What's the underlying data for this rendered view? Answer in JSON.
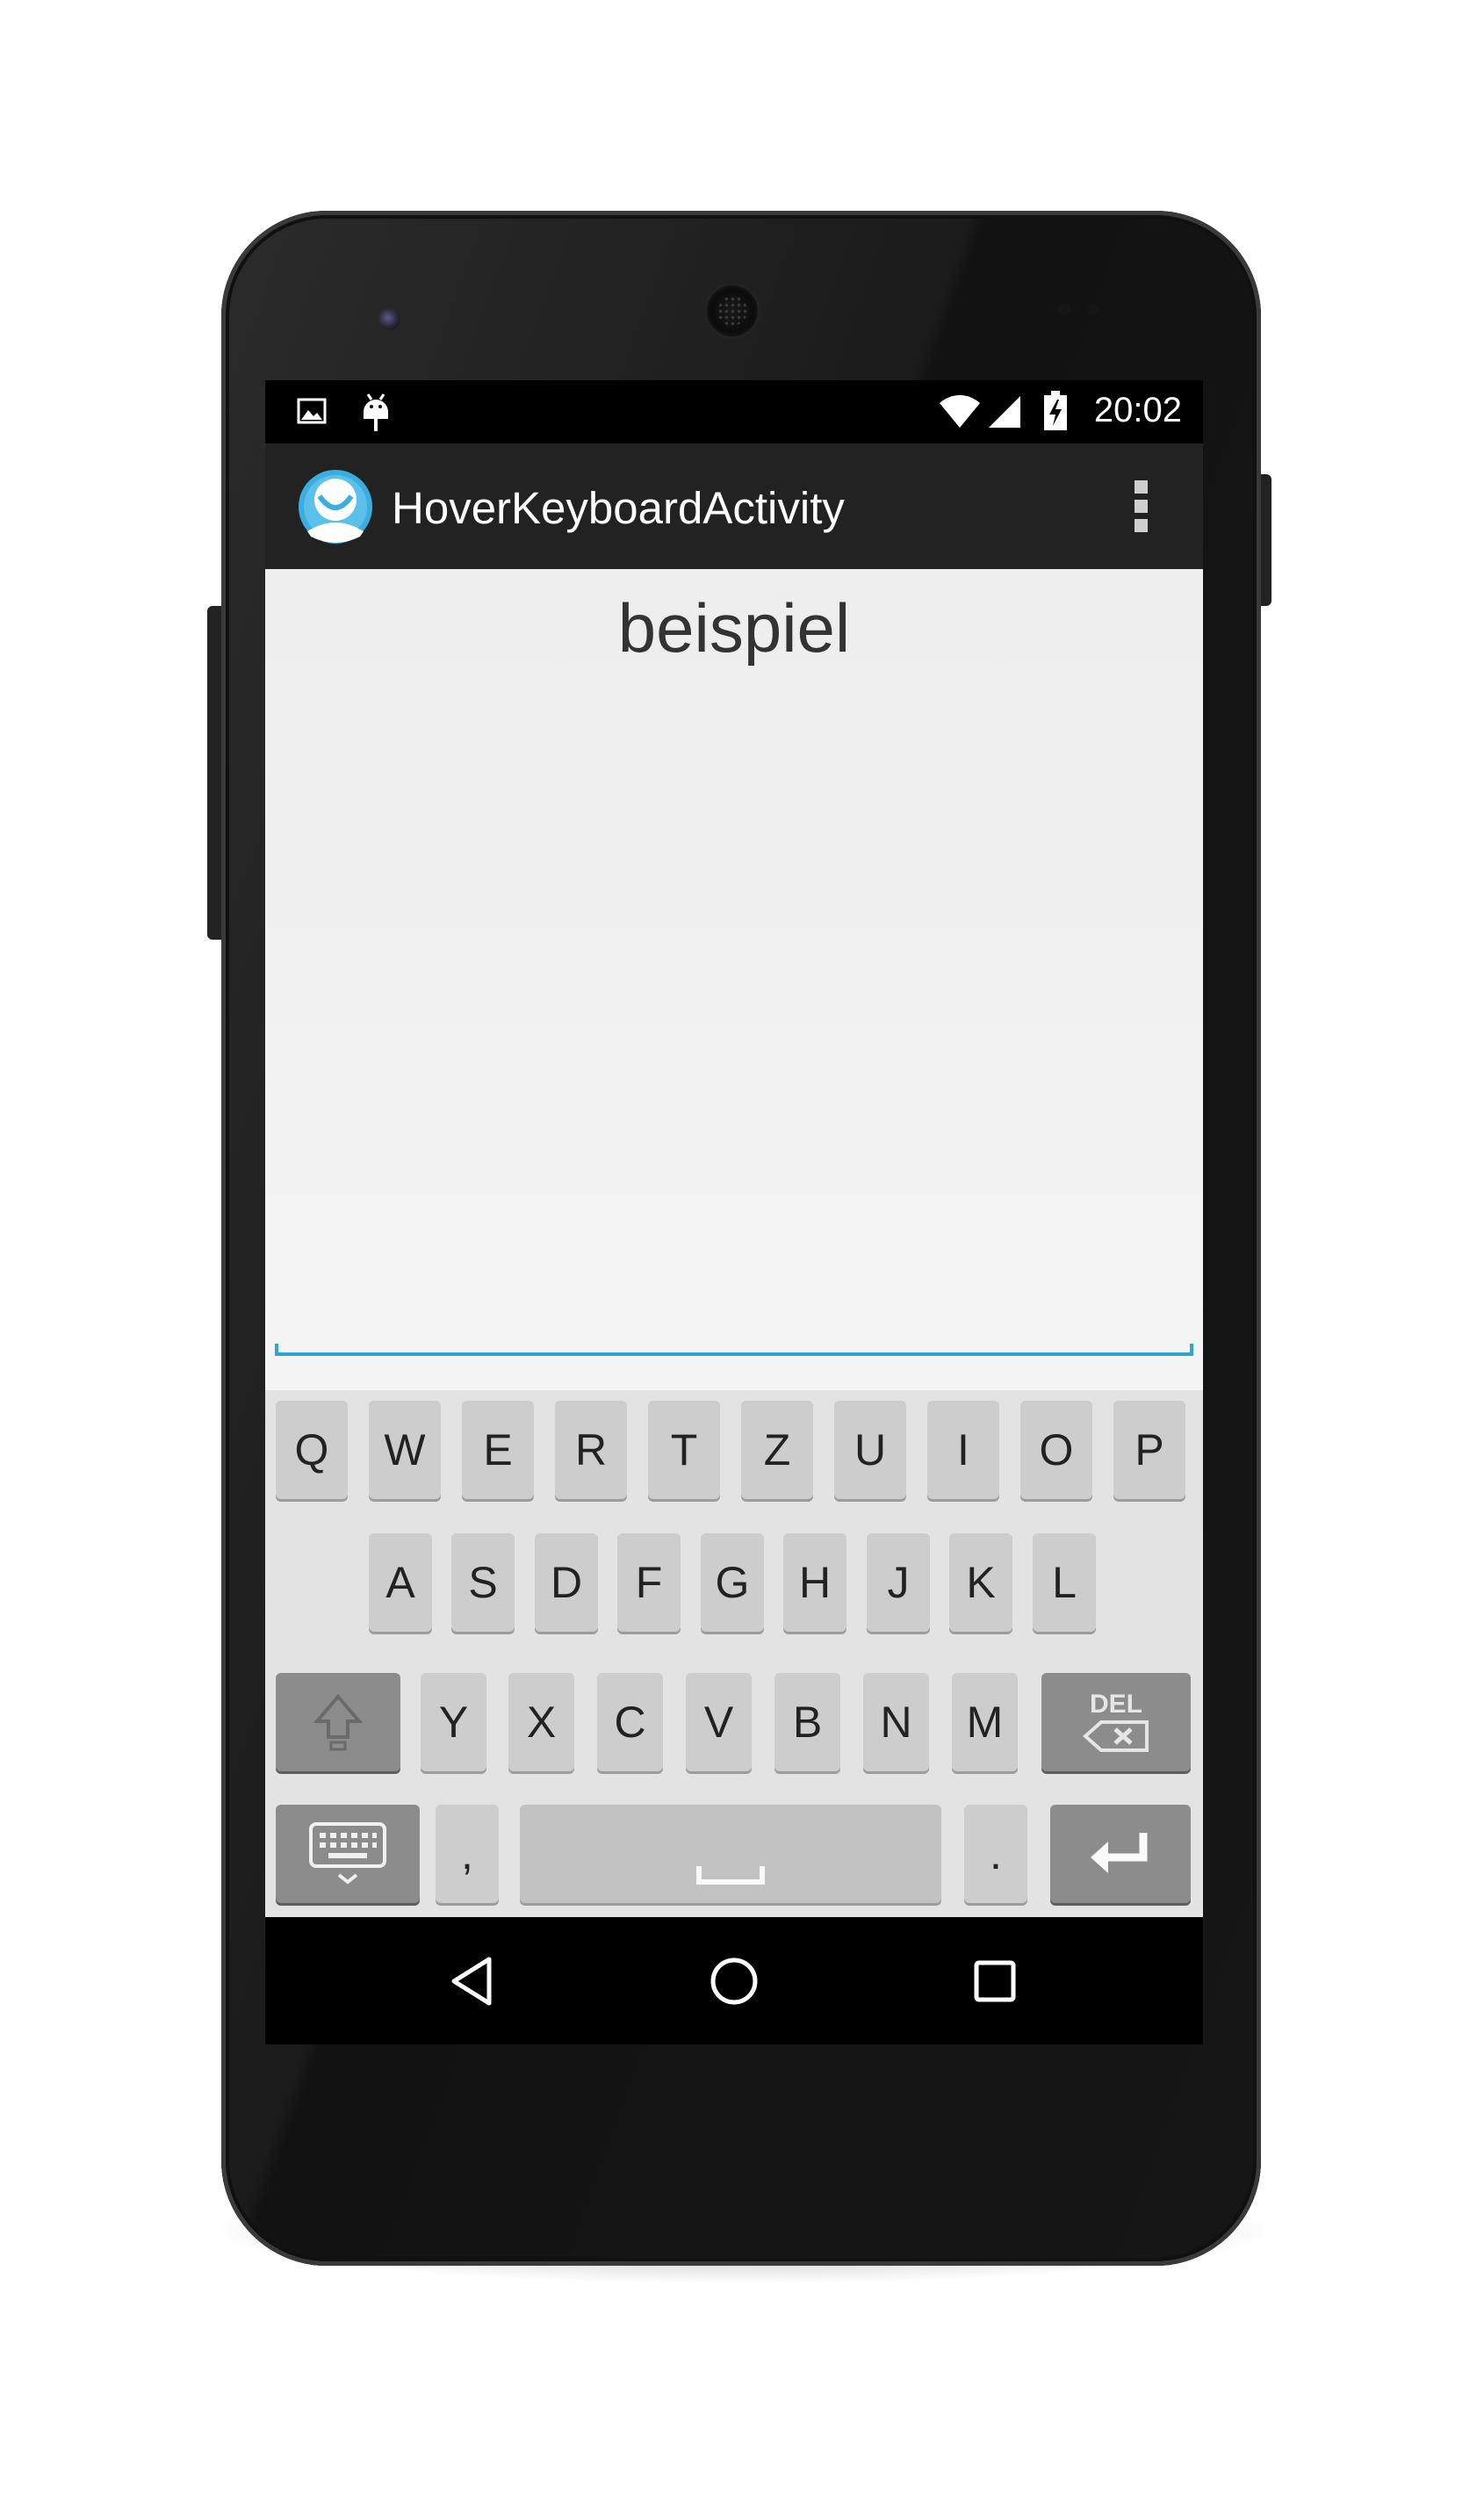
{
  "status_bar": {
    "time": "20:02",
    "left_icons": [
      "image-icon",
      "android-debug-icon"
    ],
    "right_icons": [
      "wifi-icon",
      "cell-signal-icon",
      "battery-charging-icon"
    ]
  },
  "action_bar": {
    "title": "HoverKeyboardActivity",
    "app_icon": "app-avatar-icon",
    "overflow_icon": "overflow-menu-icon"
  },
  "content": {
    "text": "beispiel",
    "input_value": ""
  },
  "keyboard": {
    "row1": [
      "Q",
      "W",
      "E",
      "R",
      "T",
      "Z",
      "U",
      "I",
      "O",
      "P"
    ],
    "row2": [
      "A",
      "S",
      "D",
      "F",
      "G",
      "H",
      "J",
      "K",
      "L"
    ],
    "row3": [
      "Y",
      "X",
      "C",
      "V",
      "B",
      "N",
      "M"
    ],
    "del_label": "DEL",
    "comma_label": ",",
    "period_label": ".",
    "icons": [
      "shift-icon",
      "backspace-icon",
      "keyboard-switch-icon",
      "space-icon",
      "enter-icon"
    ]
  },
  "nav_bar": {
    "icons": [
      "back-icon",
      "home-icon",
      "recents-icon"
    ]
  },
  "colors": {
    "action_bar": "#222222",
    "accent": "#33a3d0",
    "keyboard_bg": "#e3e3e3",
    "key": "#cdcdcd",
    "key_dark": "#8c8c8c"
  }
}
